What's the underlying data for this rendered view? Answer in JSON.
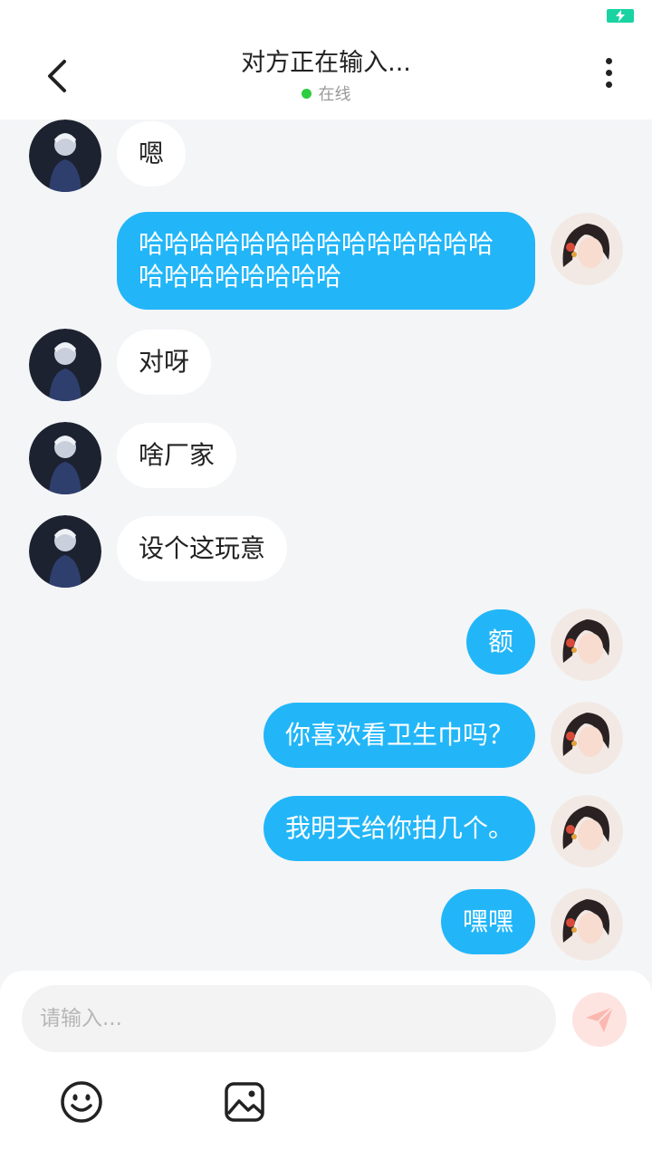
{
  "header": {
    "title": "对方正在输入...",
    "status": "在线",
    "online_color": "#2ecc40"
  },
  "colors": {
    "sent_bubble": "#22b6f8",
    "received_bubble": "#ffffff",
    "battery": "#19d3a2"
  },
  "messages": [
    {
      "side": "left",
      "text": "嗯"
    },
    {
      "side": "right",
      "text": "哈哈哈哈哈哈哈哈哈哈哈哈哈哈哈哈哈哈哈哈哈哈"
    },
    {
      "side": "left",
      "text": "对呀"
    },
    {
      "side": "left",
      "text": "啥厂家"
    },
    {
      "side": "left",
      "text": "设个这玩意"
    },
    {
      "side": "right",
      "text": "额"
    },
    {
      "side": "right",
      "text": "你喜欢看卫生巾吗？"
    },
    {
      "side": "right",
      "text": "我明天给你拍几个。"
    },
    {
      "side": "right",
      "text": "嘿嘿"
    }
  ],
  "composer": {
    "placeholder": "请输入...",
    "send_icon": "send-icon",
    "tools": [
      "emoji-icon",
      "image-icon"
    ]
  }
}
